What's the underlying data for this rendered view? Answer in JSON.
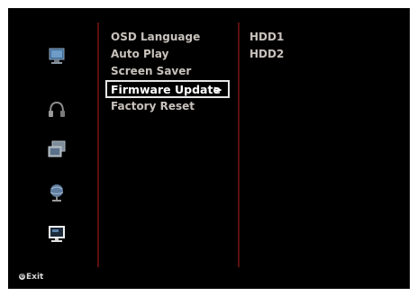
{
  "sidebar": {
    "icons": [
      {
        "name": "display-icon",
        "active": false
      },
      {
        "name": "audio-icon",
        "active": false
      },
      {
        "name": "photo-icon",
        "active": false
      },
      {
        "name": "network-icon",
        "active": false
      },
      {
        "name": "system-icon",
        "active": true
      }
    ]
  },
  "menu": {
    "items": [
      {
        "label": "OSD Language"
      },
      {
        "label": "Auto Play"
      },
      {
        "label": "Screen Saver"
      },
      {
        "label": "Firmware Update",
        "selected": true
      },
      {
        "label": "Factory Reset"
      }
    ],
    "selected_arrow": ">"
  },
  "submenu": {
    "items": [
      {
        "label": "HDD1"
      },
      {
        "label": "HDD2"
      }
    ]
  },
  "footer": {
    "exit_label": "Exit",
    "exit_icon": "exit-icon"
  },
  "colors": {
    "background": "#000000",
    "text": "#c8c2bc",
    "selected_border": "#e6e6e6",
    "divider": "#5b1010"
  }
}
